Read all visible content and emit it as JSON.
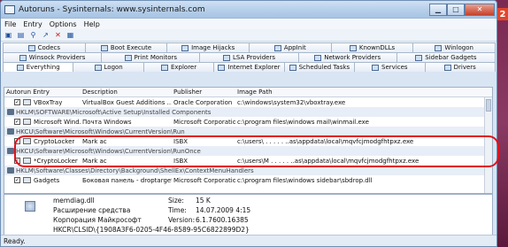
{
  "window": {
    "title": "Autoruns - Sysinternals: www.sysinternals.com"
  },
  "menu": [
    "File",
    "Entry",
    "Options",
    "Help"
  ],
  "toolbar_icons": [
    "save-icon",
    "folder-open-icon",
    "find-icon",
    "jump-icon",
    "delete-icon",
    "properties-icon"
  ],
  "tabs_row1": [
    "Codecs",
    "Boot Execute",
    "Image Hijacks",
    "AppInit",
    "KnownDLLs",
    "Winlogon"
  ],
  "tabs_row2": [
    "Winsock Providers",
    "Print Monitors",
    "LSA Providers",
    "Network Providers",
    "Sidebar Gadgets"
  ],
  "tabs_row3": [
    "Everything",
    "Logon",
    "Explorer",
    "Internet Explorer",
    "Scheduled Tasks",
    "Services",
    "Drivers"
  ],
  "columns": [
    "Autorun Entry",
    "Description",
    "Publisher",
    "Image Path"
  ],
  "rows": [
    {
      "type": "entry",
      "checked": "✓",
      "entry": "VBoxTray",
      "description": "VirtualBox Guest Additions ...",
      "publisher": "Oracle Corporation",
      "path": "c:\\windows\\system32\\vboxtray.exe"
    },
    {
      "type": "group",
      "text": "HKLM\\SOFTWARE\\Microsoft\\Active Setup\\Installed Components"
    },
    {
      "type": "entry",
      "checked": "✓",
      "entry": "Microsoft Wind...",
      "description": "Почта Windows",
      "publisher": "Microsoft Corporation",
      "path": "c:\\program files\\windows mail\\winmail.exe"
    },
    {
      "type": "group",
      "text": "HKCU\\Software\\Microsoft\\Windows\\CurrentVersion\\Run"
    },
    {
      "type": "entry",
      "checked": "✓",
      "entry": "CryptoLocker",
      "description": "Mark ac",
      "publisher": "ISBX",
      "path": "c:\\users\\ . . . . . ..as\\appdata\\local\\mqvfcjmodgfhtpxz.exe"
    },
    {
      "type": "group",
      "text": "HKCU\\Software\\Microsoft\\Windows\\CurrentVersion\\RunOnce"
    },
    {
      "type": "entry",
      "checked": "✓",
      "entry": "*CryptoLocker",
      "description": "Mark ac",
      "publisher": "ISBX",
      "path": "c:\\users\\M . . . . . ..as\\appdata\\local\\mqvfcjmodgfhtpxz.exe"
    },
    {
      "type": "group",
      "text": "HKLM\\Software\\Classes\\Directory\\Background\\ShellEx\\ContextMenuHandlers"
    },
    {
      "type": "entry",
      "checked": "✓",
      "entry": "Gadgets",
      "description": "Боковая панель - droptarget",
      "publisher": "Microsoft Corporation",
      "path": "c:\\program files\\windows sidebar\\sbdrop.dll"
    }
  ],
  "details": {
    "name": "memdiag.dll",
    "description": "Расширение средства",
    "company": "Корпорация Майкрософт",
    "size_label": "Size:",
    "size": "15 K",
    "time_label": "Time:",
    "time": "14.07.2009 4:15",
    "version_label": "Version:",
    "version": "6.1.7600.16385",
    "clsid": "HKCR\\CLSID\\{1908A3F6-0205-4F46-8589-95C6822899D2}"
  },
  "status": "Ready.",
  "badge": "2",
  "colors": {
    "highlight": "#e2111b",
    "badge": "#e2452b"
  }
}
